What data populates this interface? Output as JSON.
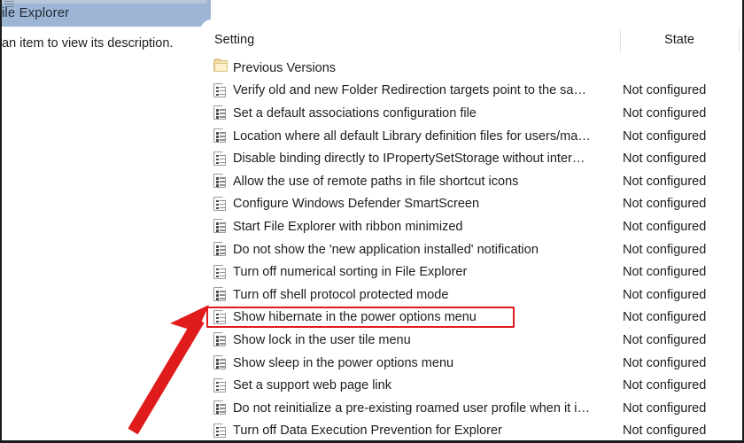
{
  "window": {
    "title": "ile Explorer",
    "title_icon": "menu-lines-icon"
  },
  "left_pane": {
    "description": "an item to view its description."
  },
  "list": {
    "columns": {
      "setting": "Setting",
      "state": "State"
    },
    "rows": [
      {
        "icon": "folder-icon",
        "label": "Previous Versions",
        "state": ""
      },
      {
        "icon": "policy-icon",
        "label": "Verify old and new Folder Redirection targets point to the sa…",
        "state": "Not configured"
      },
      {
        "icon": "policy-icon",
        "label": "Set a default associations configuration file",
        "state": "Not configured"
      },
      {
        "icon": "policy-icon",
        "label": "Location where all default Library definition files for users/ma…",
        "state": "Not configured"
      },
      {
        "icon": "policy-icon",
        "label": "Disable binding directly to IPropertySetStorage without inter…",
        "state": "Not configured"
      },
      {
        "icon": "policy-icon",
        "label": "Allow the use of remote paths in file shortcut icons",
        "state": "Not configured"
      },
      {
        "icon": "policy-icon",
        "label": "Configure Windows Defender SmartScreen",
        "state": "Not configured"
      },
      {
        "icon": "policy-icon",
        "label": "Start File Explorer with ribbon minimized",
        "state": "Not configured"
      },
      {
        "icon": "policy-icon",
        "label": "Do not show the 'new application installed' notification",
        "state": "Not configured"
      },
      {
        "icon": "policy-icon",
        "label": "Turn off numerical sorting in File Explorer",
        "state": "Not configured"
      },
      {
        "icon": "policy-icon",
        "label": "Turn off shell protocol protected mode",
        "state": "Not configured"
      },
      {
        "icon": "policy-icon",
        "label": "Show hibernate in the power options menu",
        "state": "Not configured",
        "highlighted": true
      },
      {
        "icon": "policy-icon",
        "label": "Show lock in the user tile menu",
        "state": "Not configured"
      },
      {
        "icon": "policy-icon",
        "label": "Show sleep in the power options menu",
        "state": "Not configured"
      },
      {
        "icon": "policy-icon",
        "label": "Set a support web page link",
        "state": "Not configured"
      },
      {
        "icon": "policy-icon",
        "label": "Do not reinitialize a pre-existing roamed user profile when it i…",
        "state": "Not configured"
      },
      {
        "icon": "policy-icon",
        "label": "Turn off Data Execution Prevention for Explorer",
        "state": "Not configured"
      }
    ]
  },
  "annotations": {
    "highlight_color": "#e01b1b",
    "arrow_color": "#e01b1b",
    "arrow_target_row_label": "Show hibernate in the power options menu"
  },
  "colors": {
    "titlebar_background": "#9db6d6",
    "pane_background": "#ffffff",
    "text": "#1d1d1d",
    "folder_icon": "#f6e3ae"
  }
}
